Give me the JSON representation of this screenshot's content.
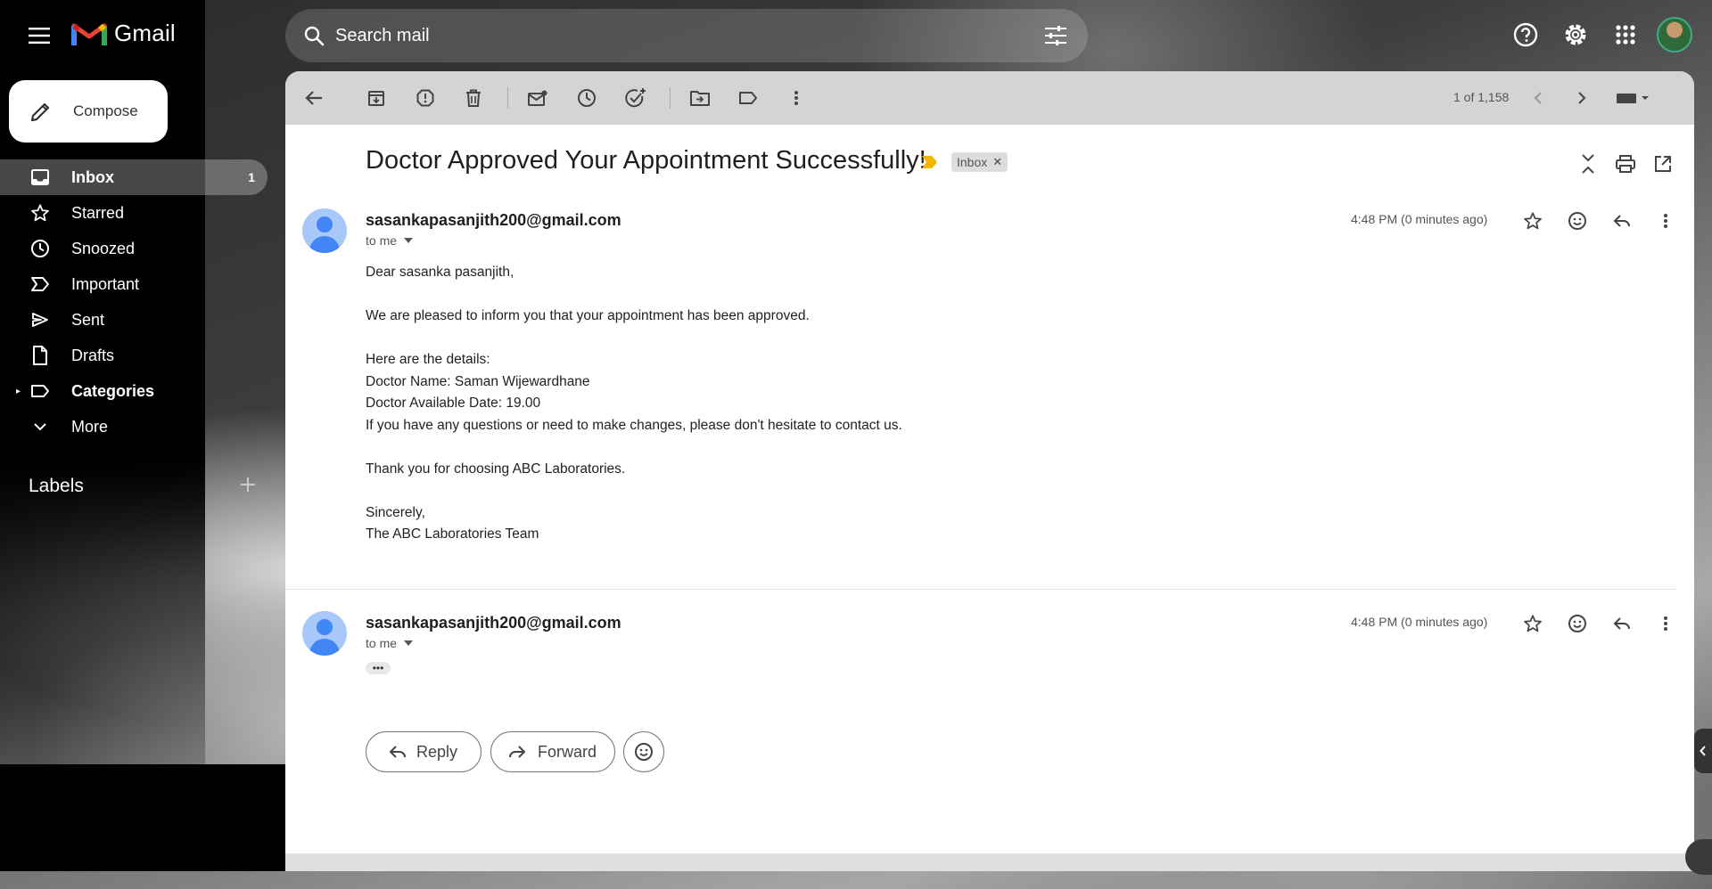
{
  "app": {
    "name": "Gmail"
  },
  "search": {
    "placeholder": "Search mail"
  },
  "compose": {
    "label": "Compose"
  },
  "sidebar": {
    "items": [
      {
        "label": "Inbox",
        "count": "1",
        "icon": "inbox-icon"
      },
      {
        "label": "Starred",
        "icon": "star-icon"
      },
      {
        "label": "Snoozed",
        "icon": "clock-icon"
      },
      {
        "label": "Important",
        "icon": "label-important-icon"
      },
      {
        "label": "Sent",
        "icon": "send-icon"
      },
      {
        "label": "Drafts",
        "icon": "draft-icon"
      },
      {
        "label": "Categories",
        "icon": "label-icon"
      },
      {
        "label": "More",
        "icon": "chevron-down-icon"
      }
    ],
    "labels_heading": "Labels"
  },
  "toolbar": {
    "pager": "1 of 1,158"
  },
  "email": {
    "subject": "Doctor Approved Your Appointment Successfully!",
    "label_chip": "Inbox",
    "messages": [
      {
        "sender": "sasankapasanjith200@gmail.com",
        "to": "to me",
        "time": "4:48 PM (0 minutes ago)",
        "body": [
          "Dear sasanka pasanjith,",
          "",
          "We are pleased to inform you that your appointment has been approved.",
          "",
          "Here are the details:",
          "Doctor Name: Saman Wijewardhane",
          "Doctor Available Date: 19.00",
          "If you have any questions or need to make changes, please don't hesitate to contact us.",
          "",
          "Thank you for choosing ABC Laboratories.",
          "",
          "Sincerely,",
          "The ABC Laboratories Team"
        ]
      },
      {
        "sender": "sasankapasanjith200@gmail.com",
        "to": "to me",
        "time": "4:48 PM (0 minutes ago)",
        "trimmed": "•••"
      }
    ]
  },
  "actions": {
    "reply": "Reply",
    "forward": "Forward"
  },
  "colors": {
    "accent": "#4285f4",
    "important": "#f4b400"
  }
}
